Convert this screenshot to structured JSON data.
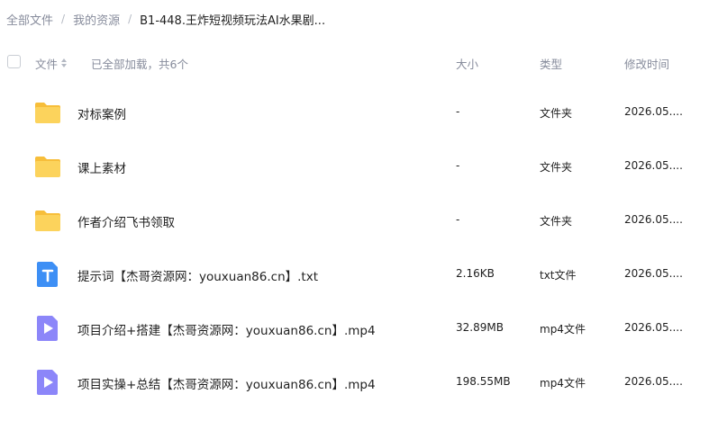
{
  "breadcrumb": {
    "items": [
      "全部文件",
      "我的资源"
    ],
    "current": "B1-448.王炸短视频玩法AI水果剧..."
  },
  "header": {
    "name_label": "文件",
    "loaded_text": "已全部加载，共6个",
    "size_label": "大小",
    "type_label": "类型",
    "time_label": "修改时间"
  },
  "colors": {
    "folder": "#fcd35c",
    "folder_tab": "#f7be3a",
    "txt": "#3d8ff5",
    "video": "#8c86f9"
  },
  "files": [
    {
      "icon": "folder-icon",
      "name": "对标案例",
      "size": "-",
      "type": "文件夹",
      "time": "2026.05...."
    },
    {
      "icon": "folder-icon",
      "name": "课上素材",
      "size": "-",
      "type": "文件夹",
      "time": "2026.05...."
    },
    {
      "icon": "folder-icon",
      "name": "作者介绍飞书领取",
      "size": "-",
      "type": "文件夹",
      "time": "2026.05...."
    },
    {
      "icon": "txt-file-icon",
      "name": "提示词【杰哥资源网：youxuan86.cn】.txt",
      "size": "2.16KB",
      "type": "txt文件",
      "time": "2026.05...."
    },
    {
      "icon": "video-file-icon",
      "name": "项目介绍+搭建【杰哥资源网：youxuan86.cn】.mp4",
      "size": "32.89MB",
      "type": "mp4文件",
      "time": "2026.05...."
    },
    {
      "icon": "video-file-icon",
      "name": "项目实操+总结【杰哥资源网：youxuan86.cn】.mp4",
      "size": "198.55MB",
      "type": "mp4文件",
      "time": "2026.05...."
    }
  ]
}
